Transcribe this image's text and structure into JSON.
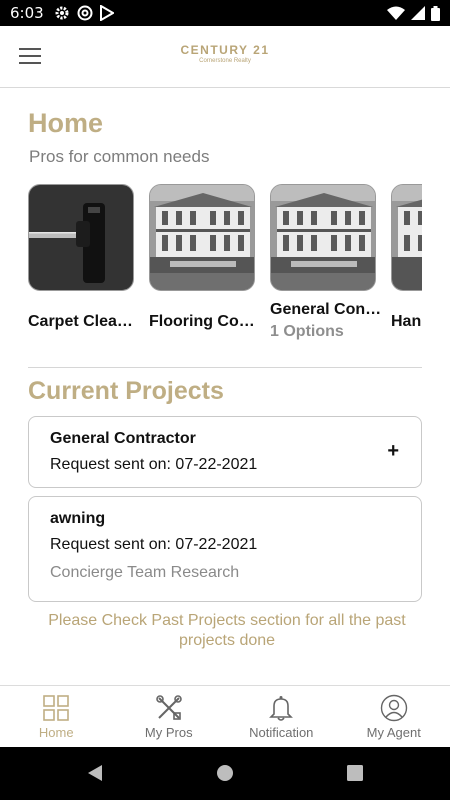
{
  "status_bar": {
    "time": "6:03",
    "icons": [
      "gear-icon",
      "at-sign-icon",
      "play-store-icon"
    ],
    "right_icons": [
      "wifi-icon",
      "signal-icon",
      "battery-icon"
    ]
  },
  "header": {
    "brand_name": "CENTURY 21",
    "brand_sub": "Cornerstone Realty",
    "menu_icon": "hamburger-menu-icon"
  },
  "home": {
    "title": "Home",
    "subtitle": "Pros for common needs"
  },
  "pros": [
    {
      "name": "Carpet Cleaning",
      "display": "Carpet Clea…",
      "options": "",
      "image": "carpet-vacuum-photo"
    },
    {
      "name": "Flooring Contractor",
      "display": "Flooring Con…",
      "options": "",
      "image": "house-photo"
    },
    {
      "name": "General Contractor",
      "display": "General Con…",
      "options": "1 Options",
      "image": "house-photo"
    },
    {
      "name": "Handyman",
      "display": "Han…",
      "options": "",
      "image": "house-photo"
    }
  ],
  "current_projects": {
    "title": "Current Projects",
    "items": [
      {
        "name": "General Contractor",
        "date": "Request sent on: 07-22-2021",
        "note": "",
        "action": "+"
      },
      {
        "name": "awning",
        "date": "Request sent on: 07-22-2021",
        "note": "Concierge Team Research",
        "action": ""
      }
    ]
  },
  "footer_note": "Please Check Past Projects section for all the past projects done",
  "tabs": [
    {
      "label": "Home",
      "icon": "grid-icon",
      "active": true
    },
    {
      "label": "My Pros",
      "icon": "tools-icon",
      "active": false
    },
    {
      "label": "Notification",
      "icon": "bell-icon",
      "active": false
    },
    {
      "label": "My Agent",
      "icon": "person-icon",
      "active": false
    }
  ],
  "colors": {
    "accent": "#bfae84",
    "text_gray": "#7d7d7d"
  }
}
